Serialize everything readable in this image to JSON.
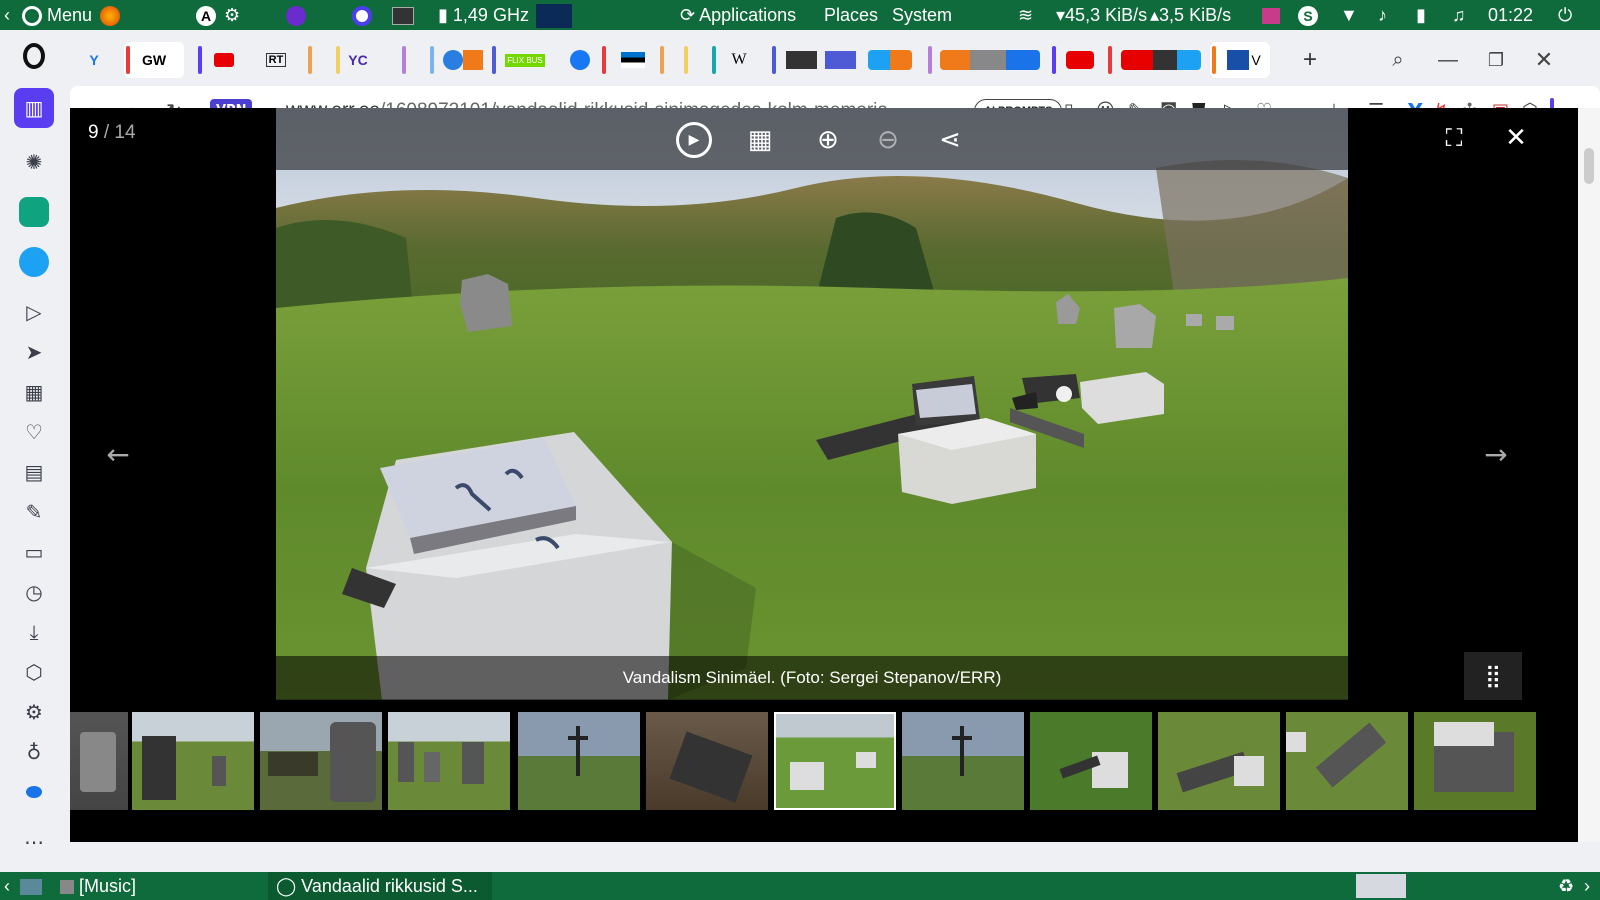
{
  "system_top": {
    "menu": "Menu",
    "cpu": "1,49 GHz",
    "applications": "Applications",
    "places": "Places",
    "system": "System",
    "net_down": "45,3 KiB/s",
    "net_up": "3,5 KiB/s",
    "clock": "01:22"
  },
  "tabs": [
    {
      "label": "GW"
    },
    {
      "label": "RT"
    },
    {
      "label": "YC"
    },
    {
      "label": "FLIX BUS"
    },
    {
      "label": "W"
    }
  ],
  "address": {
    "vpn": "VPN",
    "domain": "www.err.ee",
    "path": "/1608972101/vandaalid-rikkusid-sinimagedes-kolm-memoria",
    "ai_prompts": "AI PROMPTS"
  },
  "viewer": {
    "counter_current": "9",
    "counter_sep": " / ",
    "counter_total": "14",
    "caption": "Vandalism Sinimäel. (Foto: Sergei Stepanov/ERR)"
  },
  "system_bottom": {
    "music": "[Music]",
    "window": "Vandaalid rikkusid S..."
  },
  "colors": {
    "panel_green": "#0f6b3b",
    "accent": "#5a3df0"
  }
}
